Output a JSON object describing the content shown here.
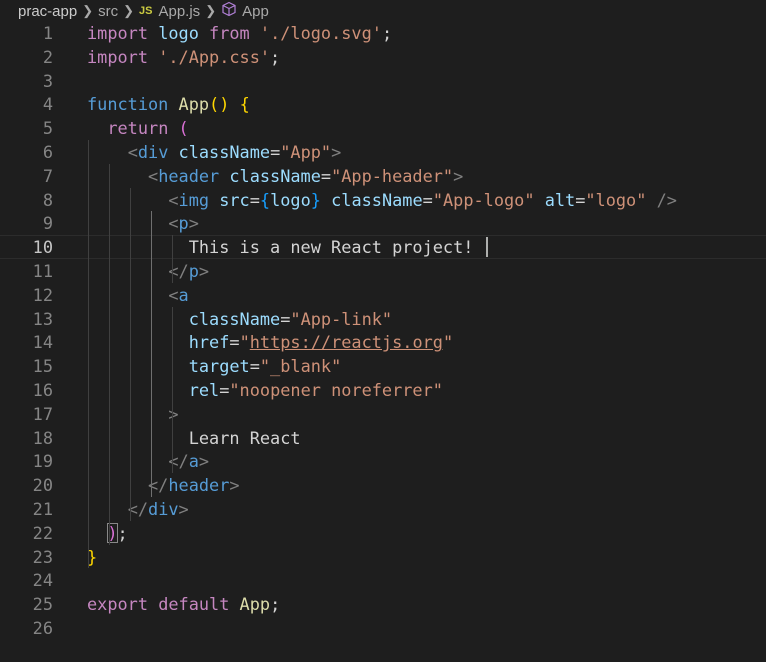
{
  "breadcrumb": {
    "project": "prac-app",
    "folder": "src",
    "file_badge": "JS",
    "file": "App.js",
    "symbol": "App",
    "separator_icon": "chevron-right-icon",
    "symbol_icon": "cube-icon"
  },
  "editor": {
    "active_line": 10,
    "lines": [
      {
        "n": "1"
      },
      {
        "n": "2"
      },
      {
        "n": "3"
      },
      {
        "n": "4"
      },
      {
        "n": "5"
      },
      {
        "n": "6"
      },
      {
        "n": "7"
      },
      {
        "n": "8"
      },
      {
        "n": "9"
      },
      {
        "n": "10"
      },
      {
        "n": "11"
      },
      {
        "n": "12"
      },
      {
        "n": "13"
      },
      {
        "n": "14"
      },
      {
        "n": "15"
      },
      {
        "n": "16"
      },
      {
        "n": "17"
      },
      {
        "n": "18"
      },
      {
        "n": "19"
      },
      {
        "n": "20"
      },
      {
        "n": "21"
      },
      {
        "n": "22"
      },
      {
        "n": "23"
      },
      {
        "n": "24"
      },
      {
        "n": "25"
      },
      {
        "n": "26"
      }
    ],
    "code": [
      [
        [
          "kw",
          "import"
        ],
        [
          "plain",
          " "
        ],
        [
          "var",
          "logo"
        ],
        [
          "plain",
          " "
        ],
        [
          "kw",
          "from"
        ],
        [
          "plain",
          " "
        ],
        [
          "str",
          "'./logo.svg'"
        ],
        [
          "plain",
          ";"
        ]
      ],
      [
        [
          "kw",
          "import"
        ],
        [
          "plain",
          " "
        ],
        [
          "str",
          "'./App.css'"
        ],
        [
          "plain",
          ";"
        ]
      ],
      [],
      [
        [
          "kwb",
          "function"
        ],
        [
          "plain",
          " "
        ],
        [
          "fn",
          "App"
        ],
        [
          "br1",
          "()"
        ],
        [
          "plain",
          " "
        ],
        [
          "br1",
          "{"
        ]
      ],
      [
        [
          "plain",
          "  "
        ],
        [
          "kw",
          "return"
        ],
        [
          "plain",
          " "
        ],
        [
          "br2",
          "("
        ]
      ],
      [
        [
          "plain",
          "    "
        ],
        [
          "punct",
          "<"
        ],
        [
          "tag",
          "div"
        ],
        [
          "plain",
          " "
        ],
        [
          "var",
          "className"
        ],
        [
          "plain",
          "="
        ],
        [
          "str",
          "\"App\""
        ],
        [
          "punct",
          ">"
        ]
      ],
      [
        [
          "plain",
          "      "
        ],
        [
          "punct",
          "<"
        ],
        [
          "tag",
          "header"
        ],
        [
          "plain",
          " "
        ],
        [
          "var",
          "className"
        ],
        [
          "plain",
          "="
        ],
        [
          "str",
          "\"App-header\""
        ],
        [
          "punct",
          ">"
        ]
      ],
      [
        [
          "plain",
          "        "
        ],
        [
          "punct",
          "<"
        ],
        [
          "tag",
          "img"
        ],
        [
          "plain",
          " "
        ],
        [
          "var",
          "src"
        ],
        [
          "plain",
          "="
        ],
        [
          "br3",
          "{"
        ],
        [
          "var",
          "logo"
        ],
        [
          "br3",
          "}"
        ],
        [
          "plain",
          " "
        ],
        [
          "var",
          "className"
        ],
        [
          "plain",
          "="
        ],
        [
          "str",
          "\"App-logo\""
        ],
        [
          "plain",
          " "
        ],
        [
          "var",
          "alt"
        ],
        [
          "plain",
          "="
        ],
        [
          "str",
          "\"logo\""
        ],
        [
          "plain",
          " "
        ],
        [
          "punct",
          "/>"
        ]
      ],
      [
        [
          "plain",
          "        "
        ],
        [
          "punct",
          "<"
        ],
        [
          "tag",
          "p"
        ],
        [
          "punct",
          ">"
        ]
      ],
      [
        [
          "plain",
          "          This is a new React project!"
        ]
      ],
      [
        [
          "plain",
          "        "
        ],
        [
          "punct",
          "</"
        ],
        [
          "tag",
          "p"
        ],
        [
          "punct",
          ">"
        ]
      ],
      [
        [
          "plain",
          "        "
        ],
        [
          "punct",
          "<"
        ],
        [
          "tag",
          "a"
        ]
      ],
      [
        [
          "plain",
          "          "
        ],
        [
          "var",
          "className"
        ],
        [
          "plain",
          "="
        ],
        [
          "str",
          "\"App-link\""
        ]
      ],
      [
        [
          "plain",
          "          "
        ],
        [
          "var",
          "href"
        ],
        [
          "plain",
          "="
        ],
        [
          "str",
          "\""
        ],
        [
          "str url",
          "https://reactjs.org"
        ],
        [
          "str",
          "\""
        ]
      ],
      [
        [
          "plain",
          "          "
        ],
        [
          "var",
          "target"
        ],
        [
          "plain",
          "="
        ],
        [
          "str",
          "\"_blank\""
        ]
      ],
      [
        [
          "plain",
          "          "
        ],
        [
          "var",
          "rel"
        ],
        [
          "plain",
          "="
        ],
        [
          "str",
          "\"noopener noreferrer\""
        ]
      ],
      [
        [
          "plain",
          "        "
        ],
        [
          "punct",
          ">"
        ]
      ],
      [
        [
          "plain",
          "          Learn React"
        ]
      ],
      [
        [
          "plain",
          "        "
        ],
        [
          "punct",
          "</"
        ],
        [
          "tag",
          "a"
        ],
        [
          "punct",
          ">"
        ]
      ],
      [
        [
          "plain",
          "      "
        ],
        [
          "punct",
          "</"
        ],
        [
          "tag",
          "header"
        ],
        [
          "punct",
          ">"
        ]
      ],
      [
        [
          "plain",
          "    "
        ],
        [
          "punct",
          "</"
        ],
        [
          "tag",
          "div"
        ],
        [
          "punct",
          ">"
        ]
      ],
      [
        [
          "plain",
          "  "
        ],
        [
          "br2 paren-box",
          ")"
        ],
        [
          "plain",
          ";"
        ]
      ],
      [
        [
          "br1",
          "}"
        ]
      ],
      [],
      [
        [
          "kw",
          "export"
        ],
        [
          "plain",
          " "
        ],
        [
          "kw",
          "default"
        ],
        [
          "plain",
          " "
        ],
        [
          "fn",
          "App"
        ],
        [
          "plain",
          ";"
        ]
      ],
      []
    ]
  }
}
